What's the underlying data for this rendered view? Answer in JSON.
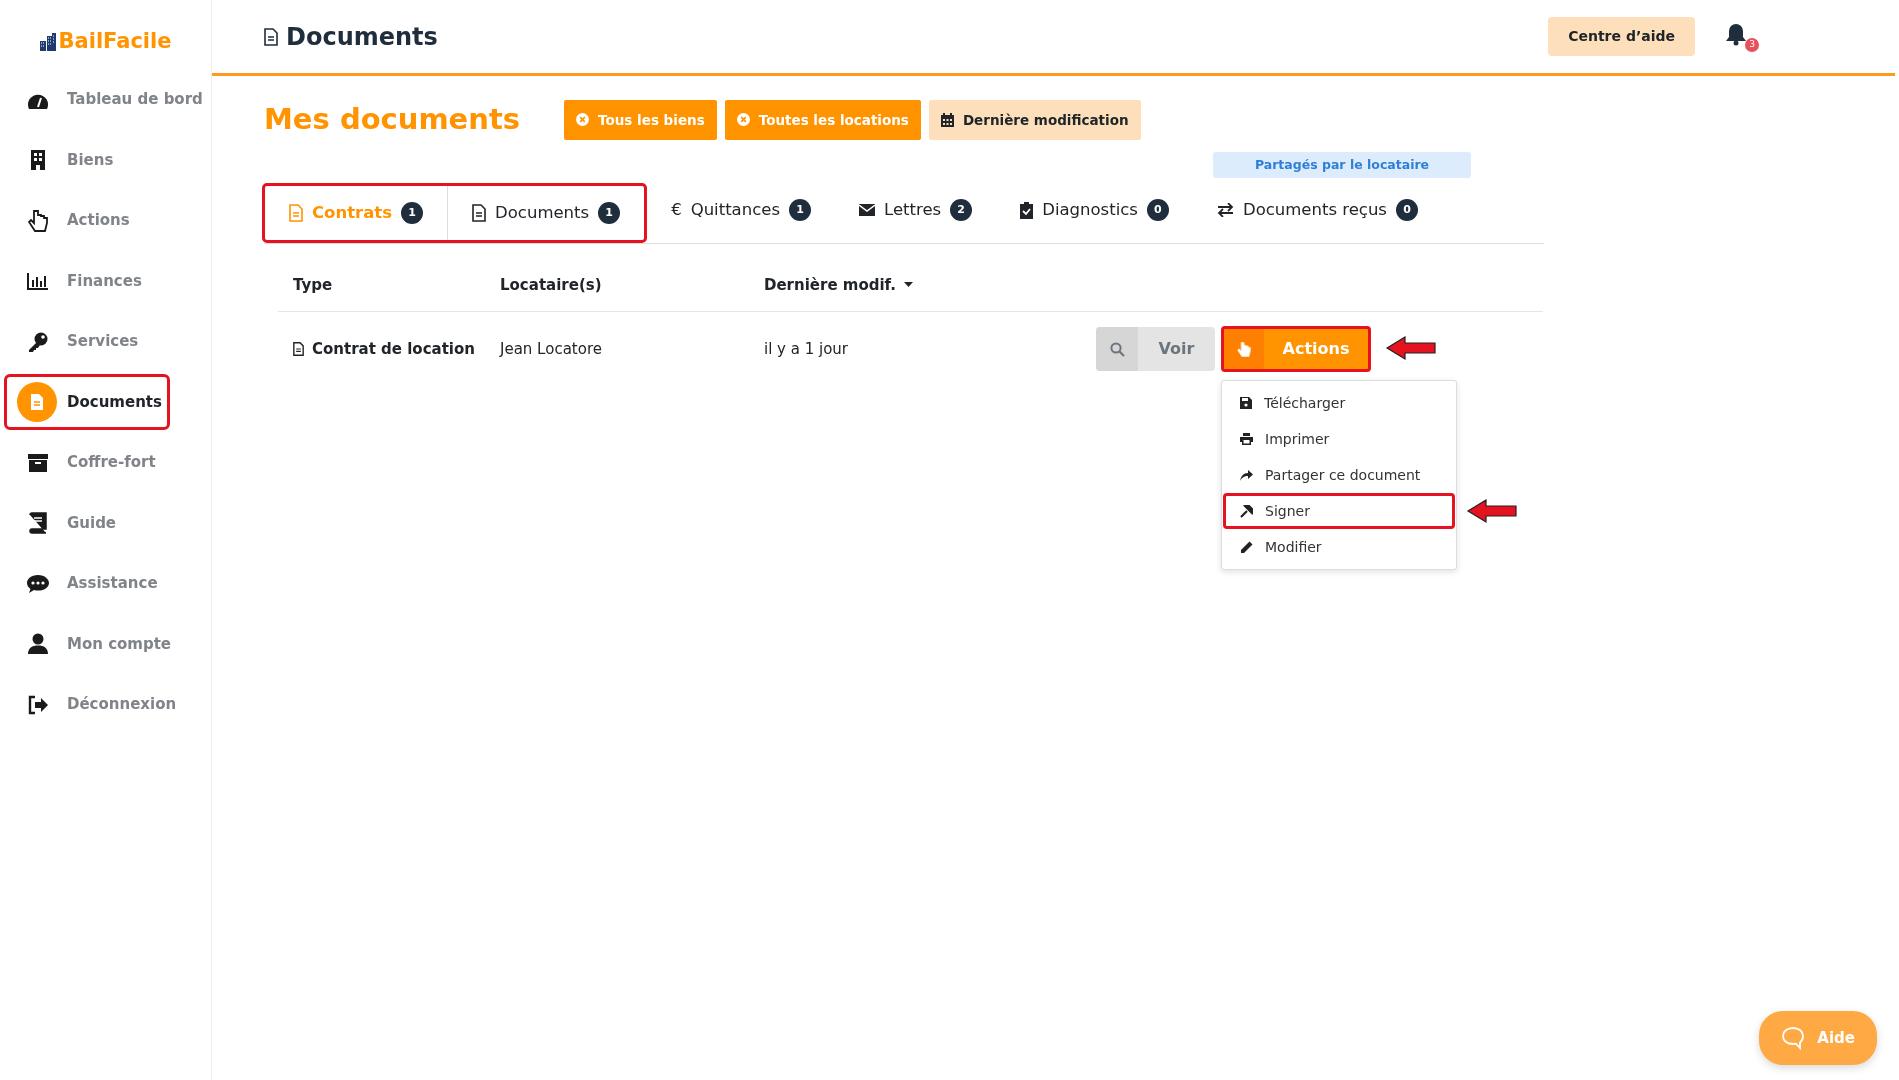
{
  "app": {
    "logo": "BailFacile"
  },
  "sidebar": {
    "items": [
      {
        "label": "Tableau de bord",
        "selected": false,
        "highlighted": false
      },
      {
        "label": "Biens",
        "selected": false,
        "highlighted": false
      },
      {
        "label": "Actions",
        "selected": false,
        "highlighted": false
      },
      {
        "label": "Finances",
        "selected": false,
        "highlighted": false
      },
      {
        "label": "Services",
        "selected": false,
        "highlighted": false
      },
      {
        "label": "Documents",
        "selected": true,
        "highlighted": true
      },
      {
        "label": "Coffre-fort",
        "selected": false,
        "highlighted": false
      },
      {
        "label": "Guide",
        "selected": false,
        "highlighted": false
      },
      {
        "label": "Assistance",
        "selected": false,
        "highlighted": false
      },
      {
        "label": "Mon compte",
        "selected": false,
        "highlighted": false
      },
      {
        "label": "Déconnexion",
        "selected": false,
        "highlighted": false
      }
    ]
  },
  "header": {
    "title": "Documents",
    "help_button": "Centre d’aide",
    "notifications": "3"
  },
  "page": {
    "title": "Mes documents",
    "filters": [
      {
        "label": "Tous les biens",
        "kind": "removable"
      },
      {
        "label": "Toutes les locations",
        "kind": "removable"
      },
      {
        "label": "Dernière modification",
        "kind": "sort"
      }
    ],
    "shared_badge": "Partagés par le locataire",
    "tabs": [
      {
        "label": "Contrats",
        "count": "1",
        "selected": true,
        "highlighted": true
      },
      {
        "label": "Documents",
        "count": "1",
        "selected": false,
        "highlighted": true
      },
      {
        "label": "Quittances",
        "icon": "€",
        "count": "1",
        "selected": false,
        "highlighted": false
      },
      {
        "label": "Lettres",
        "count": "2",
        "selected": false,
        "highlighted": false
      },
      {
        "label": "Diagnostics",
        "count": "0",
        "selected": false,
        "highlighted": false
      },
      {
        "label": "Documents reçus",
        "count": "0",
        "selected": false,
        "highlighted": false
      }
    ],
    "table": {
      "columns": [
        {
          "label": "Type",
          "sorted": false
        },
        {
          "label": "Locataire(s)",
          "sorted": false
        },
        {
          "label": "Dernière modif.",
          "sorted": true
        }
      ],
      "rows": [
        {
          "type": "Contrat de location",
          "tenant": "Jean Locatore",
          "modified": "il y a 1 jour",
          "view_button": "Voir",
          "actions_button": {
            "label": "Actions",
            "highlighted": true,
            "arrow": true
          },
          "menu": {
            "open": true,
            "items": [
              {
                "label": "Télécharger",
                "highlighted": false,
                "arrow": false
              },
              {
                "label": "Imprimer",
                "highlighted": false,
                "arrow": false
              },
              {
                "label": "Partager ce document",
                "highlighted": false,
                "arrow": false
              },
              {
                "label": "Signer",
                "highlighted": true,
                "arrow": true
              },
              {
                "label": "Modifier",
                "highlighted": false,
                "arrow": false
              }
            ]
          }
        }
      ]
    }
  },
  "help_widget": {
    "label": "Aide"
  }
}
